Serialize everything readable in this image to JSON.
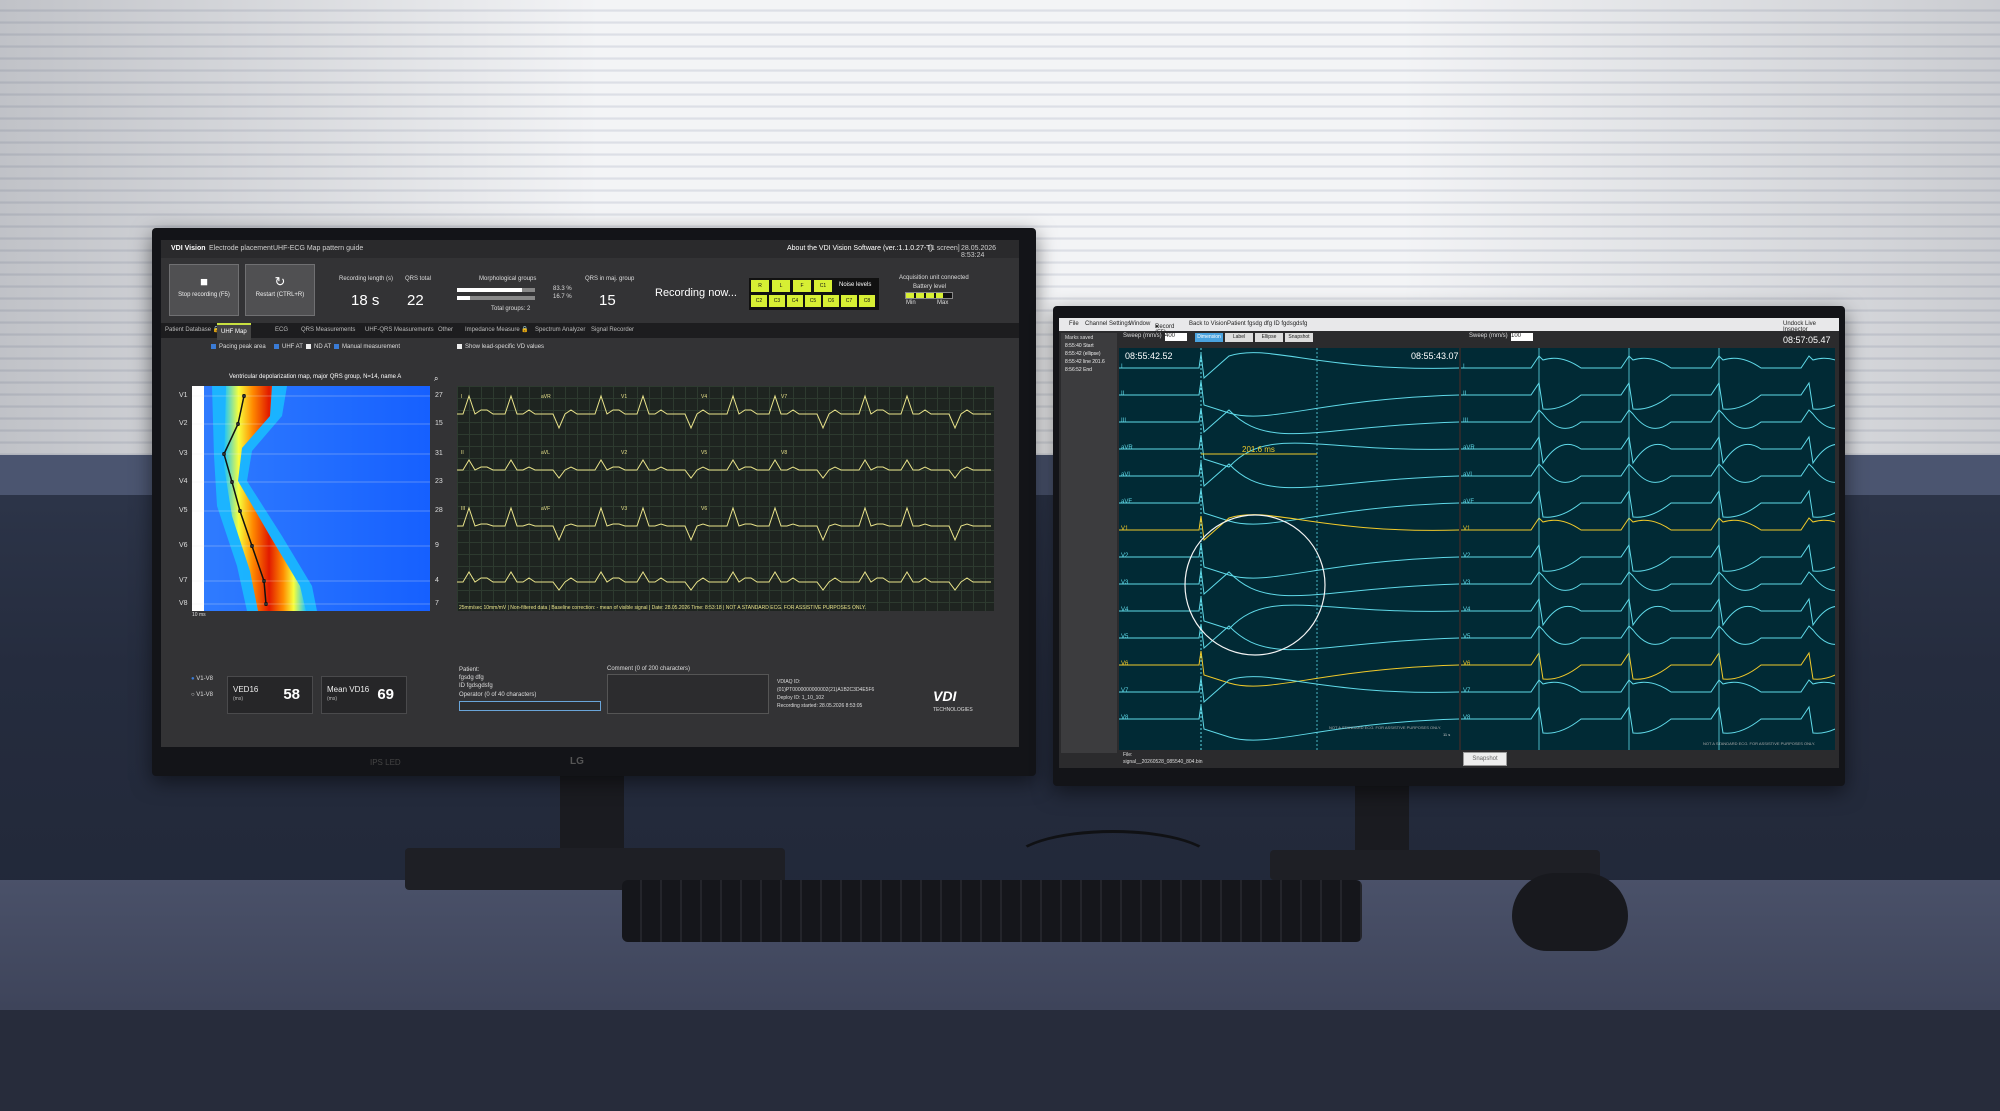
{
  "left_app": {
    "title": "VDI Vision",
    "menu": [
      "Electrode placement",
      "UHF-ECG Map pattern guide"
    ],
    "about": "About the VDI Vision Software (ver.:1.1.0.27-T)",
    "screen_label": "[1 screen]",
    "datetime": "28.05.2026 8:53:24",
    "buttons": {
      "stop": "Stop recording (F5)",
      "restart": "Restart (CTRL+R)"
    },
    "stats": {
      "recording_length_label": "Recording length (s)",
      "recording_length_value": "18 s",
      "qrs_total_label": "QRS total",
      "qrs_total_value": "22",
      "morph_label": "Morphological groups",
      "morph_a_pct": "83.3 %",
      "morph_b_pct": "16.7 %",
      "total_groups": "Total groups: 2",
      "qrs_maj_label": "QRS in maj. group",
      "qrs_maj_value": "15",
      "status": "Recording now..."
    },
    "noise": {
      "label": "Noise levels",
      "top": [
        "R",
        "L",
        "F",
        "C1"
      ],
      "bottom": [
        "C2",
        "C3",
        "C4",
        "C5",
        "C6",
        "C7",
        "C8"
      ]
    },
    "battery": {
      "title": "Acquisition unit connected",
      "label": "Battery level",
      "min": "Min",
      "max": "Max"
    },
    "tabs": [
      "Patient Database",
      "UHF Map",
      "ECG",
      "QRS Measurements",
      "UHF-QRS Measurements",
      "Other",
      "Impedance Measure",
      "Spectrum Analyzer",
      "Signal Recorder"
    ],
    "options": {
      "pacing": "Pacing peak area",
      "uhf_at": "UHF AT",
      "nd_at": "ND AT",
      "manual": "Manual measurement",
      "lead_specific": "Show lead-specific VD values"
    },
    "map_title": "Ventricular depolarization map, major QRS group, N=14, name A",
    "leads": [
      "V1",
      "V2",
      "V3",
      "V4",
      "V5",
      "V6",
      "V7",
      "V8"
    ],
    "lead_values": [
      "27",
      "15",
      "31",
      "23",
      "28",
      "9",
      "4",
      "7"
    ],
    "scale_label": "10 ms",
    "ecg_leads": [
      "I",
      "II",
      "III",
      "aVR",
      "aVL",
      "aVF",
      "V1",
      "V2",
      "V3",
      "V4",
      "V5",
      "V6",
      "V7",
      "V8"
    ],
    "ecg_footer": "25mm/sec   10mm/mV | Non-filtered data | Baseline correction: - mean of visible signal | Date: 28.05.2026 Time: 8:53:18 | NOT A STANDARD ECG. FOR ASSISTIVE PURPOSES ONLY.",
    "radio": [
      "V1-V8",
      "V1-V8"
    ],
    "ved16": {
      "label": "VED16",
      "unit": "(ms)",
      "value": "58"
    },
    "mean_vd16": {
      "label": "Mean VD16",
      "unit": "(ms)",
      "value": "69"
    },
    "patient": {
      "label": "Patient:",
      "name": "fgsdg dfg",
      "id": "ID fgdsgdsfg",
      "operator_label": "Operator (0 of 40 characters)"
    },
    "comment_label": "Comment (0 of 200 characters)",
    "device": {
      "vdiaq": "VDIAQ ID:",
      "vdiaq_value": "(01)PT0000000000002(21)A1B2C3D4E5F6",
      "deploy": "Deploy ID: 1_10_102",
      "started": "Recording started: 28.05.2026  8:53:05"
    },
    "logo": "VDI",
    "logo_sub": "TECHNOLOGIES",
    "bezel_brand": "LG",
    "bezel_ips": "IPS LED"
  },
  "right_app": {
    "menu": [
      "File",
      "Channel Settings",
      "Window",
      "Record (F5)",
      "Back to Vision",
      "Patient fgsdg dfg ID fgdsgdsfg"
    ],
    "undock": "Undock Live Inspector",
    "marks_label": "Marks saved",
    "marks": [
      "8:55:40  Start",
      "8:55:42  (ellipse)",
      "8:55:42  line 201.6",
      "8:56:52  End"
    ],
    "sweep_label": "Sweep (mm/s)",
    "sweep_left": "400",
    "sweep_right": "100",
    "tools": [
      "Dimension",
      "Label",
      "Ellipse",
      "Snapshot"
    ],
    "time_left_start": "08:55:42.52",
    "time_left_end": "08:55:43.07",
    "time_right": "08:57:05.47",
    "measurement": "201.6 ms",
    "leads": [
      "I",
      "II",
      "III",
      "aVR",
      "aVL",
      "aVF",
      "V1",
      "V2",
      "V3",
      "V4",
      "V5",
      "V6",
      "V7",
      "V8"
    ],
    "disclaimer": "NOT A STANDARD ECG. FOR ASSISTIVE PURPOSES ONLY.",
    "file_label": "File:",
    "file_name": "signal__20260528_085540_804.bin",
    "snapshot_btn": "Snapshot",
    "bottom_scale": "11 s"
  },
  "colors": {
    "accent_green": "#d7ef34",
    "ecg_yellow": "#e9e38a",
    "trace_cyan": "#5fd9e8",
    "trace_yellow": "#f0c92a",
    "panel_bg": "#012a35"
  }
}
